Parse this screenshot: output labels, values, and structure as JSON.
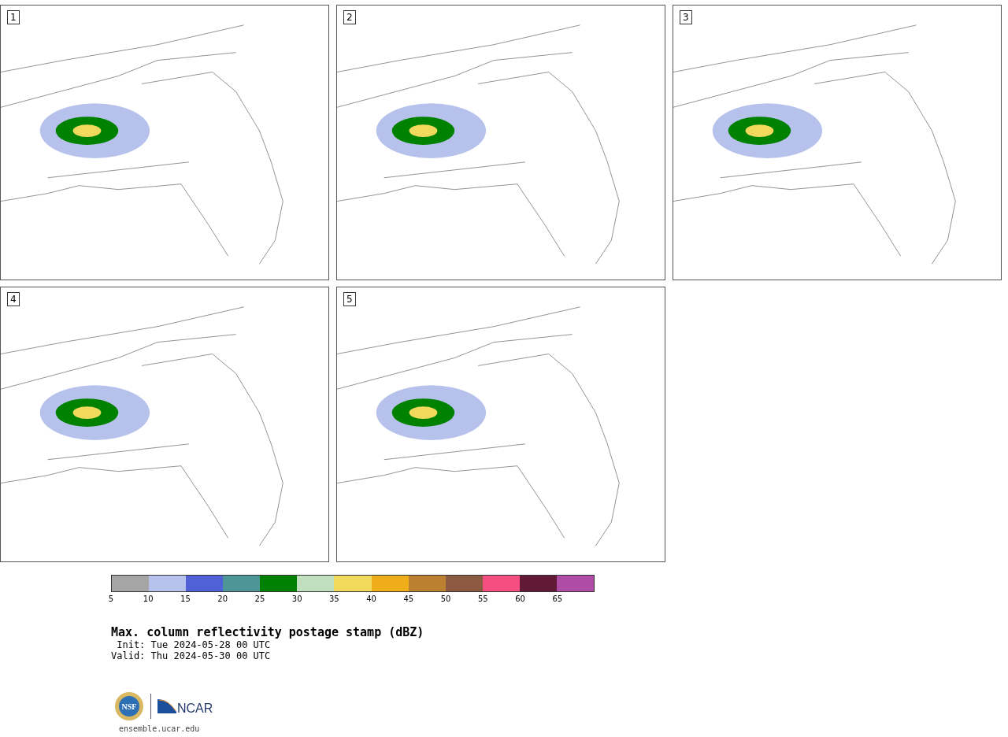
{
  "panels": [
    {
      "label": "1"
    },
    {
      "label": "2"
    },
    {
      "label": "3"
    },
    {
      "label": "4"
    },
    {
      "label": "5"
    }
  ],
  "colorbar": {
    "bins": [
      {
        "color": "#a5a5a5"
      },
      {
        "color": "#b7c2ec"
      },
      {
        "color": "#5060d6"
      },
      {
        "color": "#4e9598"
      },
      {
        "color": "#008100"
      },
      {
        "color": "#bfdfbf"
      },
      {
        "color": "#f0d95c"
      },
      {
        "color": "#efad1a"
      },
      {
        "color": "#bc8130"
      },
      {
        "color": "#8c5a40"
      },
      {
        "color": "#f44f80"
      },
      {
        "color": "#621936"
      },
      {
        "color": "#b04ca6"
      }
    ],
    "ticks": [
      "5",
      "10",
      "15",
      "20",
      "25",
      "30",
      "35",
      "40",
      "45",
      "50",
      "55",
      "60",
      "65"
    ]
  },
  "title": "Max. column reflectivity postage stamp (dBZ)",
  "init": " Init: Tue 2024-05-28 00 UTC",
  "valid": "Valid: Thu 2024-05-30 00 UTC",
  "logo": {
    "nsf": "NSF",
    "ncar": "NCAR"
  },
  "site": "ensemble.ucar.edu"
}
